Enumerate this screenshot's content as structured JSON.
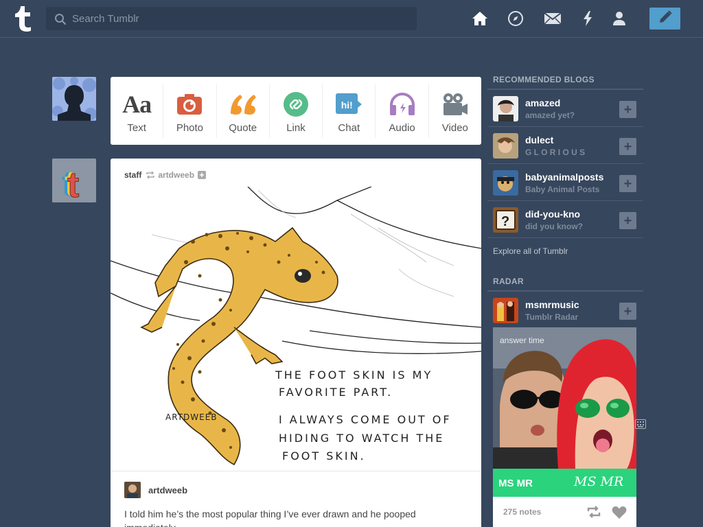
{
  "header": {
    "search_placeholder": "Search Tumblr",
    "logo_letter": "t"
  },
  "composer": {
    "types": [
      {
        "label": "Text",
        "icon": "text-icon",
        "glyph": "Aa",
        "color": "#444444"
      },
      {
        "label": "Photo",
        "icon": "camera-icon",
        "color": "#d95e40"
      },
      {
        "label": "Quote",
        "icon": "quote-icon",
        "glyph": "66",
        "color": "#f2992e"
      },
      {
        "label": "Link",
        "icon": "link-icon",
        "color": "#56bc8a"
      },
      {
        "label": "Chat",
        "icon": "chat-icon",
        "glyph": "hi!",
        "color": "#529ecc"
      },
      {
        "label": "Audio",
        "icon": "headphones-icon",
        "color": "#a77dc2"
      },
      {
        "label": "Video",
        "icon": "video-camera-icon",
        "color": "#748089"
      }
    ]
  },
  "post": {
    "author": "staff",
    "reblogged_from": "artdweeb",
    "image_text": {
      "line1": "THE FOOT SKIN IS MY",
      "line2": "FAVORITE PART.",
      "line3": "I ALWAYS COME OUT OF",
      "line4": "HIDING TO WATCH THE",
      "line5": "FOOT SKIN.",
      "signature": "ARTDWEEB"
    },
    "reblogger": "artdweeb",
    "caption": "I told him he’s the most popular thing I’ve ever drawn and he pooped immediately."
  },
  "sidebar": {
    "recommended_title": "RECOMMENDED BLOGS",
    "blogs": [
      {
        "name": "amazed",
        "desc": "amazed yet?"
      },
      {
        "name": "dulect",
        "desc": "G L O R I O U S"
      },
      {
        "name": "babyanimalposts",
        "desc": "Baby Animal Posts"
      },
      {
        "name": "did-you-kno",
        "desc": "did you know?"
      }
    ],
    "follow_glyph": "+",
    "explore": "Explore all of Tumblr",
    "radar_title": "RADAR",
    "radar": {
      "name": "msmrmusic",
      "desc": "Tumblr Radar",
      "overlay": "answer time",
      "caption_left": "MS MR",
      "caption_right": "MS MR",
      "notes": "275 notes"
    }
  },
  "colors": {
    "background": "#36465d",
    "accent": "#529ecc",
    "radar_green": "#2bd37d"
  }
}
